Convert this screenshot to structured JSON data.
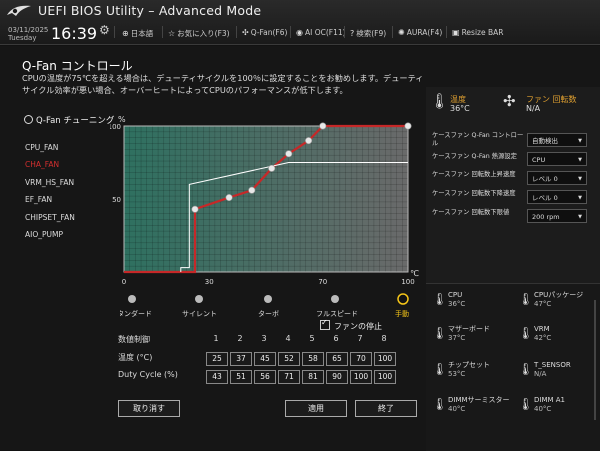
{
  "app": {
    "title": "UEFI BIOS Utility – Advanced Mode",
    "date": "03/11/2025",
    "day": "Tuesday",
    "time": "16:39"
  },
  "toolbar": [
    {
      "icon": "globe-icon",
      "glyph": "⊕",
      "label": "日本語"
    },
    {
      "icon": "star-icon",
      "glyph": "☆",
      "label": "お気に入り(F3)"
    },
    {
      "icon": "fan-icon",
      "glyph": "✣",
      "label": "Q-Fan(F6)"
    },
    {
      "icon": "ai-oc-icon",
      "glyph": "◉",
      "label": "AI OC(F11)"
    },
    {
      "icon": "help-icon",
      "glyph": "?",
      "label": "検索(F9)"
    },
    {
      "icon": "aura-icon",
      "glyph": "✺",
      "label": "AURA(F4)"
    },
    {
      "icon": "resize-bar-icon",
      "glyph": "▣",
      "label": "Resize BAR"
    }
  ],
  "qfan": {
    "title": "Q-Fan コントロール",
    "description": "CPUの温度が75℃を超える場合は、デューティサイクルを100％に設定することをお勧めします。デューティサイクル効率が悪い場合、オーバーヒートによってCPUのパフォーマンスが低下します。",
    "tuning_label": "Q-Fan チューニング",
    "fans": [
      "CPU_FAN",
      "CHA_FAN",
      "VRM_HS_FAN",
      "EF_FAN",
      "CHIPSET_FAN",
      "AIO_PUMP"
    ],
    "active_fan": 1
  },
  "chart_data": {
    "type": "line",
    "y_unit": "%",
    "x_unit": "℃",
    "xlim": [
      0,
      100
    ],
    "ylim": [
      0,
      100
    ],
    "x_ticks": [
      0,
      30,
      70,
      100
    ],
    "y_ticks": [
      50,
      100
    ],
    "grid": true,
    "series": [
      {
        "color": "#c62828",
        "points": [
          [
            0,
            0
          ],
          [
            25,
            0
          ],
          [
            25,
            43
          ],
          [
            37,
            51
          ],
          [
            45,
            56
          ],
          [
            52,
            71
          ],
          [
            58,
            81
          ],
          [
            65,
            90
          ],
          [
            70,
            100
          ],
          [
            100,
            100
          ]
        ]
      },
      {
        "color": "#ffffff",
        "points": [
          [
            20,
            0
          ],
          [
            20,
            3
          ],
          [
            23,
            3
          ],
          [
            23,
            60
          ],
          [
            58,
            75
          ],
          [
            100,
            75
          ]
        ]
      }
    ],
    "control_points": [
      [
        25,
        43
      ],
      [
        37,
        51
      ],
      [
        45,
        56
      ],
      [
        52,
        71
      ],
      [
        58,
        81
      ],
      [
        65,
        90
      ],
      [
        70,
        100
      ],
      [
        100,
        100
      ]
    ]
  },
  "presets": {
    "items": [
      "スタンダード",
      "サイレント",
      "ターボ",
      "フルスピード",
      "手動"
    ],
    "selected": 4
  },
  "stop_fan_label": "ファンの停止",
  "table": {
    "header_label": "数値制御",
    "indices": [
      "1",
      "2",
      "3",
      "4",
      "5",
      "6",
      "7",
      "8"
    ],
    "temp_label": "温度 (°C)",
    "temps": [
      "25",
      "37",
      "45",
      "52",
      "58",
      "65",
      "70",
      "100"
    ],
    "duty_label": "Duty Cycle (%)",
    "duties": [
      "43",
      "51",
      "56",
      "71",
      "81",
      "90",
      "100",
      "100"
    ]
  },
  "buttons": {
    "cancel": "取り消す",
    "apply": "適用",
    "exit": "終了"
  },
  "status": {
    "temp_label": "温度",
    "temp_value": "36°C",
    "fan_label": "ファン 回転数",
    "fan_value": "N/A"
  },
  "settings": [
    {
      "label": "ケースファン Q-Fan コントロール",
      "value": "自動検出"
    },
    {
      "label": "ケースファン Q-Fan 熱源設定",
      "value": "CPU"
    },
    {
      "label": "ケースファン 回転数上昇速度",
      "value": "レベル 0"
    },
    {
      "label": "ケースファン 回転数下降速度",
      "value": "レベル 0"
    },
    {
      "label": "ケースファン 回転数下限値",
      "value": "200 rpm"
    }
  ],
  "hardware": [
    {
      "label": "CPU",
      "value": "36°C"
    },
    {
      "label": "CPUパッケージ",
      "value": "47°C"
    },
    {
      "label": "マザーボード",
      "value": "37°C"
    },
    {
      "label": "VRM",
      "value": "42°C"
    },
    {
      "label": "チップセット",
      "value": "53°C"
    },
    {
      "label": "T_SENSOR",
      "value": "N/A"
    },
    {
      "label": "DIMMサーミスター",
      "value": "40°C"
    },
    {
      "label": "DIMM A1",
      "value": "40°C"
    }
  ]
}
